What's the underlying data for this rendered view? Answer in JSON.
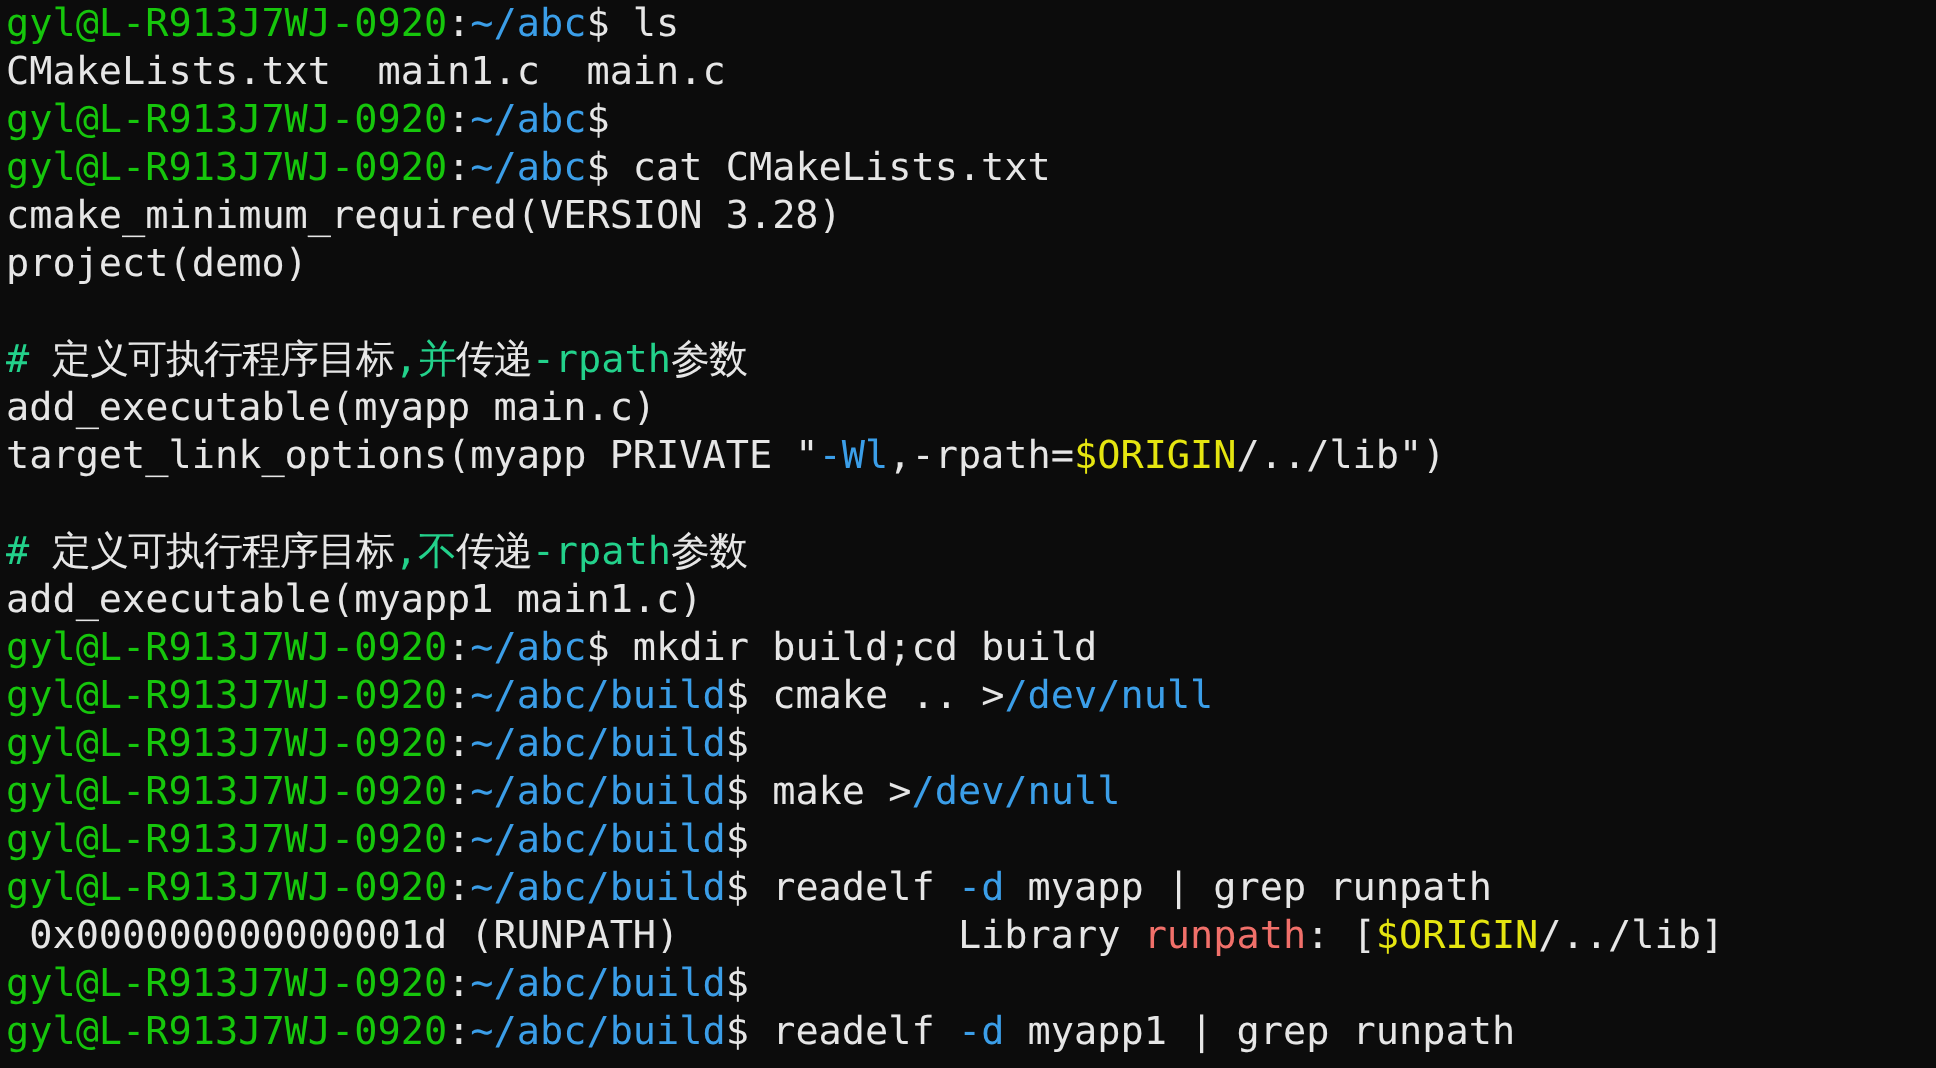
{
  "terminal": {
    "lines": [
      {
        "kind": "text",
        "segments": [
          {
            "kind": "user",
            "text": "gyl@L-R913J7WJ-0920"
          },
          {
            "kind": "plain",
            "text": ":"
          },
          {
            "kind": "path",
            "text": "~/abc"
          },
          {
            "kind": "plain",
            "text": "$ ls"
          }
        ]
      },
      {
        "kind": "text",
        "segments": [
          {
            "kind": "plain",
            "text": "CMakeLists.txt  main1.c  main.c"
          }
        ]
      },
      {
        "kind": "text",
        "segments": [
          {
            "kind": "user",
            "text": "gyl@L-R913J7WJ-0920"
          },
          {
            "kind": "plain",
            "text": ":"
          },
          {
            "kind": "path",
            "text": "~/abc"
          },
          {
            "kind": "plain",
            "text": "$"
          }
        ]
      },
      {
        "kind": "text",
        "segments": [
          {
            "kind": "user",
            "text": "gyl@L-R913J7WJ-0920"
          },
          {
            "kind": "plain",
            "text": ":"
          },
          {
            "kind": "path",
            "text": "~/abc"
          },
          {
            "kind": "plain",
            "text": "$ cat CMakeLists.txt"
          }
        ]
      },
      {
        "kind": "text",
        "segments": [
          {
            "kind": "plain",
            "text": "cmake_minimum_required(VERSION 3.28)"
          }
        ]
      },
      {
        "kind": "text",
        "segments": [
          {
            "kind": "plain",
            "text": "project(demo)"
          }
        ]
      },
      {
        "kind": "blank"
      },
      {
        "kind": "text",
        "segments": [
          {
            "kind": "comment",
            "text": "# "
          },
          {
            "kind": "plain",
            "text": "定义可执行程序目标"
          },
          {
            "kind": "comment",
            "text": ",并"
          },
          {
            "kind": "plain",
            "text": "传递"
          },
          {
            "kind": "comment",
            "text": "-rpath"
          },
          {
            "kind": "plain",
            "text": "参数"
          }
        ]
      },
      {
        "kind": "text",
        "segments": [
          {
            "kind": "plain",
            "text": "add_executable(myapp main.c)"
          }
        ]
      },
      {
        "kind": "text",
        "segments": [
          {
            "kind": "plain",
            "text": "target_link_options(myapp PRIVATE \""
          },
          {
            "kind": "option",
            "text": "-Wl"
          },
          {
            "kind": "plain",
            "text": ",-rpath="
          },
          {
            "kind": "variable",
            "text": "$ORIGIN"
          },
          {
            "kind": "plain",
            "text": "/../lib\")"
          }
        ]
      },
      {
        "kind": "blank"
      },
      {
        "kind": "text",
        "segments": [
          {
            "kind": "comment",
            "text": "# "
          },
          {
            "kind": "plain",
            "text": "定义可执行程序目标"
          },
          {
            "kind": "comment",
            "text": ",不"
          },
          {
            "kind": "plain",
            "text": "传递"
          },
          {
            "kind": "comment",
            "text": "-rpath"
          },
          {
            "kind": "plain",
            "text": "参数"
          }
        ]
      },
      {
        "kind": "text",
        "segments": [
          {
            "kind": "plain",
            "text": "add_executable(myapp1 main1.c)"
          }
        ]
      },
      {
        "kind": "text",
        "segments": [
          {
            "kind": "user",
            "text": "gyl@L-R913J7WJ-0920"
          },
          {
            "kind": "plain",
            "text": ":"
          },
          {
            "kind": "path",
            "text": "~/abc"
          },
          {
            "kind": "plain",
            "text": "$ mkdir build;cd build"
          }
        ]
      },
      {
        "kind": "text",
        "segments": [
          {
            "kind": "user",
            "text": "gyl@L-R913J7WJ-0920"
          },
          {
            "kind": "plain",
            "text": ":"
          },
          {
            "kind": "path",
            "text": "~/abc/build"
          },
          {
            "kind": "plain",
            "text": "$ cmake .. >"
          },
          {
            "kind": "path",
            "text": "/dev/null"
          }
        ]
      },
      {
        "kind": "text",
        "segments": [
          {
            "kind": "user",
            "text": "gyl@L-R913J7WJ-0920"
          },
          {
            "kind": "plain",
            "text": ":"
          },
          {
            "kind": "path",
            "text": "~/abc/build"
          },
          {
            "kind": "plain",
            "text": "$"
          }
        ]
      },
      {
        "kind": "text",
        "segments": [
          {
            "kind": "user",
            "text": "gyl@L-R913J7WJ-0920"
          },
          {
            "kind": "plain",
            "text": ":"
          },
          {
            "kind": "path",
            "text": "~/abc/build"
          },
          {
            "kind": "plain",
            "text": "$ make >"
          },
          {
            "kind": "path",
            "text": "/dev/null"
          }
        ]
      },
      {
        "kind": "text",
        "segments": [
          {
            "kind": "user",
            "text": "gyl@L-R913J7WJ-0920"
          },
          {
            "kind": "plain",
            "text": ":"
          },
          {
            "kind": "path",
            "text": "~/abc/build"
          },
          {
            "kind": "plain",
            "text": "$"
          }
        ]
      },
      {
        "kind": "text",
        "segments": [
          {
            "kind": "user",
            "text": "gyl@L-R913J7WJ-0920"
          },
          {
            "kind": "plain",
            "text": ":"
          },
          {
            "kind": "path",
            "text": "~/abc/build"
          },
          {
            "kind": "plain",
            "text": "$ readelf "
          },
          {
            "kind": "option",
            "text": "-d"
          },
          {
            "kind": "plain",
            "text": " myapp | grep runpath"
          }
        ]
      },
      {
        "kind": "text",
        "segments": [
          {
            "kind": "plain",
            "text": " 0x000000000000001d (RUNPATH)            Library "
          },
          {
            "kind": "match",
            "text": "runpath"
          },
          {
            "kind": "plain",
            "text": ": ["
          },
          {
            "kind": "variable",
            "text": "$ORIGIN"
          },
          {
            "kind": "plain",
            "text": "/../lib]"
          }
        ]
      },
      {
        "kind": "text",
        "segments": [
          {
            "kind": "user",
            "text": "gyl@L-R913J7WJ-0920"
          },
          {
            "kind": "plain",
            "text": ":"
          },
          {
            "kind": "path",
            "text": "~/abc/build"
          },
          {
            "kind": "plain",
            "text": "$"
          }
        ]
      },
      {
        "kind": "text",
        "segments": [
          {
            "kind": "user",
            "text": "gyl@L-R913J7WJ-0920"
          },
          {
            "kind": "plain",
            "text": ":"
          },
          {
            "kind": "path",
            "text": "~/abc/build"
          },
          {
            "kind": "plain",
            "text": "$ readelf "
          },
          {
            "kind": "option",
            "text": "-d"
          },
          {
            "kind": "plain",
            "text": " myapp1 | grep runpath"
          }
        ]
      }
    ]
  }
}
